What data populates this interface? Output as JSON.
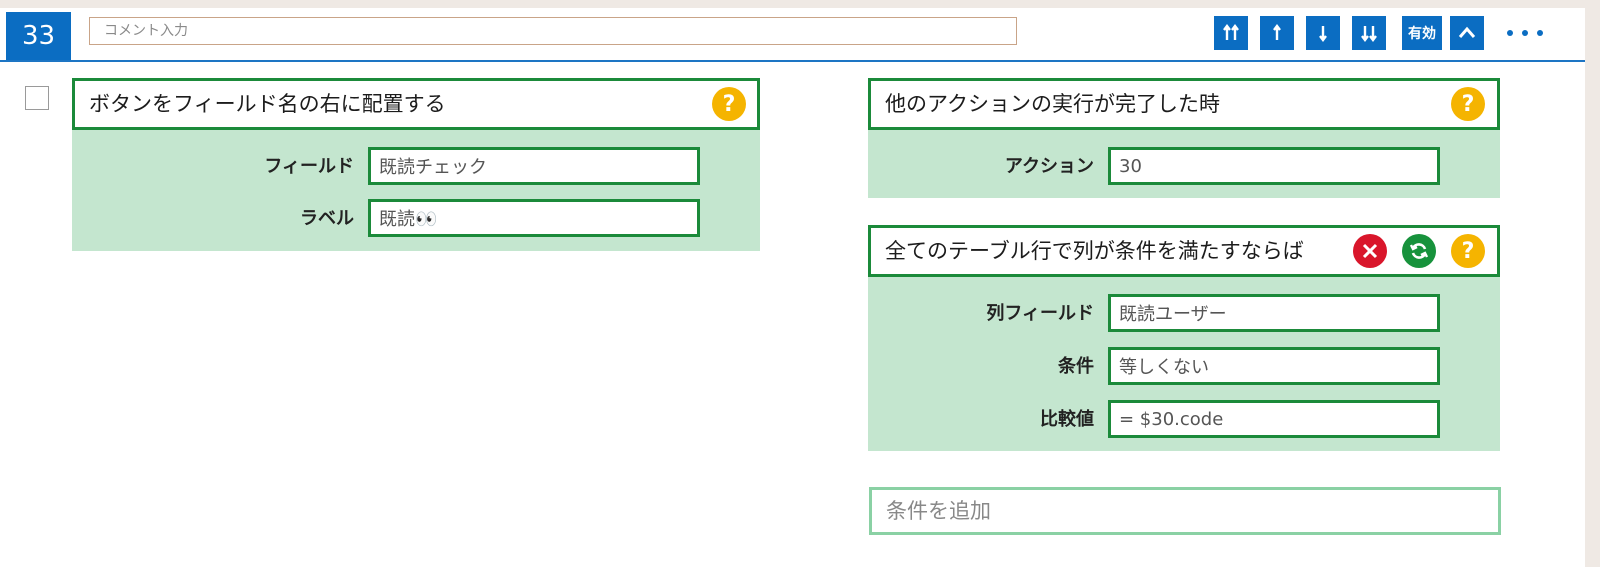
{
  "header": {
    "step_number": "33",
    "comment_placeholder": "コメント入力",
    "enabled_label": "有効"
  },
  "left_panel": {
    "title": "ボタンをフィールド名の右に配置する",
    "rows": [
      {
        "label": "フィールド",
        "value": "既読チェック"
      },
      {
        "label": "ラベル",
        "value": "既読👀"
      }
    ]
  },
  "trigger_panel": {
    "title": "他のアクションの実行が完了した時",
    "rows": [
      {
        "label": "アクション",
        "value": "30"
      }
    ]
  },
  "condition_panel": {
    "title": "全てのテーブル行で列が条件を満たすならば",
    "rows": [
      {
        "label": "列フィールド",
        "value": "既読ユーザー"
      },
      {
        "label": "条件",
        "value": "等しくない"
      },
      {
        "label": "比較値",
        "value": "= $30.code"
      }
    ]
  },
  "add_condition_label": "条件を追加",
  "icons": {
    "help": "question-icon",
    "remove": "close-icon",
    "refresh": "refresh-icon",
    "move_top": "move-to-top-icon",
    "move_up": "move-up-icon",
    "move_down": "move-down-icon",
    "move_bottom": "move-to-bottom-icon",
    "collapse": "chevron-up-icon",
    "more": "more-icon"
  },
  "colors": {
    "accent_blue": "#0b6dc2",
    "panel_green_border": "#1b8a3a",
    "panel_green_bg": "#c4e6cf",
    "help_yellow": "#f5b400",
    "remove_red": "#d9162b",
    "refresh_green": "#17923c"
  }
}
